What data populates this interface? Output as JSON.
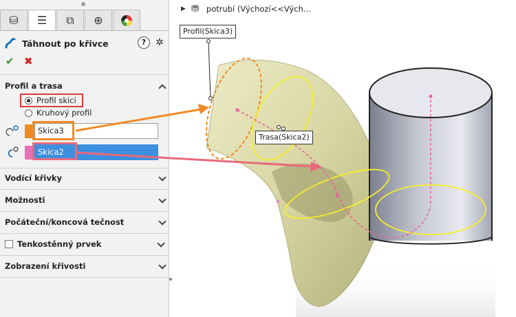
{
  "panel": {
    "tabs": [
      {
        "icon": "feature-manager-icon",
        "active": false
      },
      {
        "icon": "property-manager-icon",
        "active": true
      },
      {
        "icon": "configuration-manager-icon",
        "active": false
      },
      {
        "icon": "dimxpert-icon",
        "active": false
      },
      {
        "icon": "display-manager-icon",
        "active": false
      }
    ],
    "feature_title": "Táhnout po křivce",
    "help_label": "?",
    "ok_icon": "check-icon",
    "cancel_icon": "close-icon",
    "groups": {
      "profile_path": "Profil a trasa",
      "guide_curves": "Vodící křivky",
      "options": "Možnosti",
      "tangency": "Počáteční/koncová tečnost",
      "thin_feature": "Tenkostěnný prvek",
      "curvature_display": "Zobrazení křivosti"
    },
    "radio_sketch_profile": "Profil skici",
    "radio_circular_profile": "Kruhový profil",
    "profile_selection": "Skica3",
    "path_selection": "Skica2",
    "colors": {
      "profile_swatch": "#f08a24",
      "path_swatch": "#e870b8",
      "highlight_red": "#e23a3a"
    }
  },
  "viewport": {
    "tree_label": "potrubí  (Výchozí<<Vých...",
    "callout_profile": "Profil(Skica3)",
    "callout_path": "Trasa(Skica2)"
  }
}
